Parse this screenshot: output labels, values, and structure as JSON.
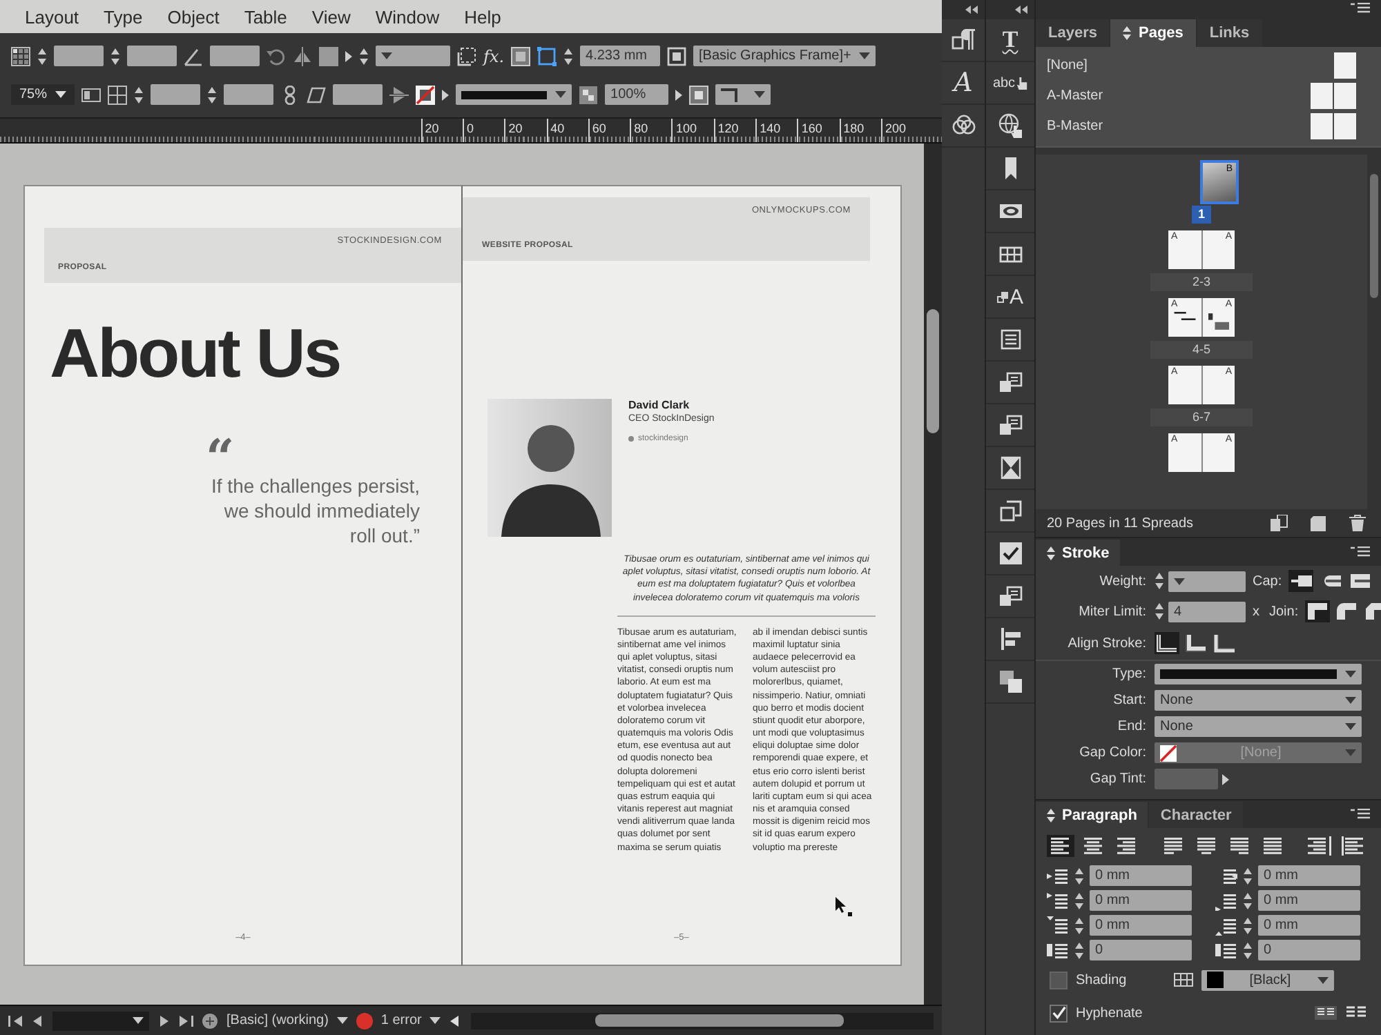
{
  "menu_bar": {
    "items": [
      "Layout",
      "Type",
      "Object",
      "Table",
      "View",
      "Window",
      "Help"
    ]
  },
  "control_bar": {
    "zoom": "75%",
    "effects_label": "fx.",
    "offset": "4.233 mm",
    "opacity": "100%",
    "object_style": "[Basic Graphics Frame]+"
  },
  "ruler": {
    "ticks": [
      "20",
      "0",
      "20",
      "40",
      "60",
      "80",
      "100",
      "120",
      "140",
      "160",
      "180",
      "200"
    ]
  },
  "spread": {
    "left_page": {
      "header_left": "PROPOSAL",
      "header_right": "STOCKINDESIGN.COM",
      "heading": "About Us",
      "quote_mark": "“",
      "quote_lines": [
        "If the challenges persist,",
        "we should immediately",
        "roll out.”"
      ],
      "page_number": "–4–"
    },
    "right_page": {
      "header_left": "WEBSITE PROPOSAL",
      "header_right": "ONLYMOCKUPS.COM",
      "profile": {
        "name": "David Clark",
        "role": "CEO StockInDesign",
        "handle": "stockindesign"
      },
      "intro": "Tibusae orum es outaturiam, sintibernat ame vel inimos qui aplet voluptus, sitasi vitatist, consedi oruptis num loborio. At eum est ma doluptatem fugiatatur? Quis et volorlbea invelecea doloratemo corum vit quatemquis ma voloris",
      "columns": [
        "Tibusae arum es autaturiam, sintibernat ame vel inimos qui aplet voluptus, sitasi vitatist, consedi oruptis num laborio. At eum est ma doluptatem fugiatatur? Quis et volorbea invelecea doloratemo corum vit quatemquis ma voloris Odis etum, ese eventusa aut aut od quodis nonecto bea dolupta doloremeni tempeliquam qui est et autat quas estrum eaquia qui vitanis reperest aut magniat vendi alitiverrum quae landa quas dolumet por sent maxima se serum quiatis",
        "ab il imendan debisci suntis maximil luptatur sinia audaece pelecerrovid ea volum autesciist pro molorerlbus, quiamet, nissimperio. Natiur, omniati quo berro et modis docient stiunt quodit etur aborpore, unt modi que voluptasimus eliqui doluptae sime dolor remporendi quae expere, et etus erio corro islenti berist autem dolupid et porrum ut lariti cuptam eum si qui acea nis et aramquia consed mossit is digenim reicid mos sit id quas earum expero voluptio ma prereste"
      ],
      "page_number": "–5–"
    }
  },
  "status_bar": {
    "profile": "[Basic] (working)",
    "preflight": "1 error",
    "has_errors": true
  },
  "dock": {
    "left_strip": [
      {
        "kind": "pilcrow"
      },
      {
        "kind": "script",
        "glyph": "A"
      },
      {
        "kind": "rings"
      }
    ],
    "right_strip": [
      {
        "kind": "letter",
        "glyph": "T"
      },
      {
        "kind": "hand",
        "glyph": "abc"
      },
      {
        "kind": "globe"
      },
      {
        "kind": "bookmark"
      },
      {
        "kind": "slide"
      },
      {
        "kind": "table"
      },
      {
        "kind": "shapes",
        "glyph": "A"
      },
      {
        "kind": "list"
      },
      {
        "kind": "stack"
      },
      {
        "kind": "stack"
      },
      {
        "kind": "hourglass"
      },
      {
        "kind": "export"
      },
      {
        "kind": "check"
      },
      {
        "kind": "stack"
      },
      {
        "kind": "align"
      },
      {
        "kind": "overlap"
      }
    ]
  },
  "pages_panel": {
    "tabs": [
      {
        "label": "Layers",
        "selected": false
      },
      {
        "label": "Pages",
        "selected": true
      },
      {
        "label": "Links",
        "selected": false
      }
    ],
    "masters": [
      {
        "label": "[None]",
        "kind": "single"
      },
      {
        "label": "A-Master",
        "kind": "spread"
      },
      {
        "label": "B-Master",
        "kind": "spread"
      }
    ],
    "spreads": [
      {
        "label": "1",
        "selected": true,
        "kind": "photo",
        "masters": [
          "B"
        ]
      },
      {
        "label": "2-3",
        "selected": false,
        "kind": "blank",
        "masters": [
          "A",
          "A"
        ]
      },
      {
        "label": "4-5",
        "selected": false,
        "kind": "layout",
        "masters": [
          "A",
          "A"
        ]
      },
      {
        "label": "6-7",
        "selected": false,
        "kind": "blank",
        "masters": [
          "A",
          "A"
        ]
      },
      {
        "selected": false,
        "kind": "blank",
        "masters": [
          "A",
          "A"
        ]
      }
    ],
    "summary": "20 Pages in 11 Spreads"
  },
  "stroke_panel": {
    "title": "Stroke",
    "weight_label": "Weight:",
    "cap_label": "Cap:",
    "caps": [
      {
        "kind": "butt",
        "selected": true
      },
      {
        "kind": "round",
        "selected": false
      },
      {
        "kind": "projecting",
        "selected": false
      }
    ],
    "miter_label": "Miter Limit:",
    "miter_value": "4",
    "miter_unit": "x",
    "join_label": "Join:",
    "joins": [
      {
        "kind": "miter",
        "selected": true
      },
      {
        "kind": "round",
        "selected": false
      },
      {
        "kind": "bevel",
        "selected": false
      }
    ],
    "align_label": "Align Stroke:",
    "aligns": [
      {
        "kind": "center",
        "selected": true
      },
      {
        "kind": "inside",
        "selected": false
      },
      {
        "kind": "outside",
        "selected": false
      }
    ],
    "type_label": "Type:",
    "start_label": "Start:",
    "start_value": "None",
    "end_label": "End:",
    "end_value": "None",
    "gap_color_label": "Gap Color:",
    "gap_color_value": "[None]",
    "gap_color_disabled": true,
    "gap_tint_label": "Gap Tint:",
    "gap_tint_disabled": true
  },
  "paragraph_panel": {
    "tabs": [
      {
        "label": "Paragraph",
        "selected": true
      },
      {
        "label": "Character",
        "selected": false
      }
    ],
    "alignments": [
      {
        "kind": "left",
        "selected": true
      },
      {
        "kind": "center",
        "selected": false
      },
      {
        "kind": "right",
        "selected": false
      },
      {
        "kind": "justifyleft",
        "selected": false
      },
      {
        "kind": "justifycenter",
        "selected": false
      },
      {
        "kind": "justifyright",
        "selected": false
      },
      {
        "kind": "justifyall",
        "selected": false
      },
      {
        "kind": "towardspine",
        "selected": false
      },
      {
        "kind": "awayspine",
        "selected": false
      }
    ],
    "fields": [
      {
        "kind": "leftindent",
        "value": "0 mm"
      },
      {
        "kind": "rightindent",
        "value": "0 mm"
      },
      {
        "kind": "firstline",
        "value": "0 mm"
      },
      {
        "kind": "lastline",
        "value": "0 mm"
      },
      {
        "kind": "spacebefore",
        "value": "0 mm"
      },
      {
        "kind": "spaceafter",
        "value": "0 mm"
      },
      {
        "kind": "dropcaplines",
        "value": "0"
      },
      {
        "kind": "dropcapchars",
        "value": "0"
      }
    ],
    "shading": {
      "label": "Shading",
      "checked": false
    },
    "shading_color": "[Black]",
    "hyphenate": {
      "label": "Hyphenate",
      "checked": true
    }
  }
}
